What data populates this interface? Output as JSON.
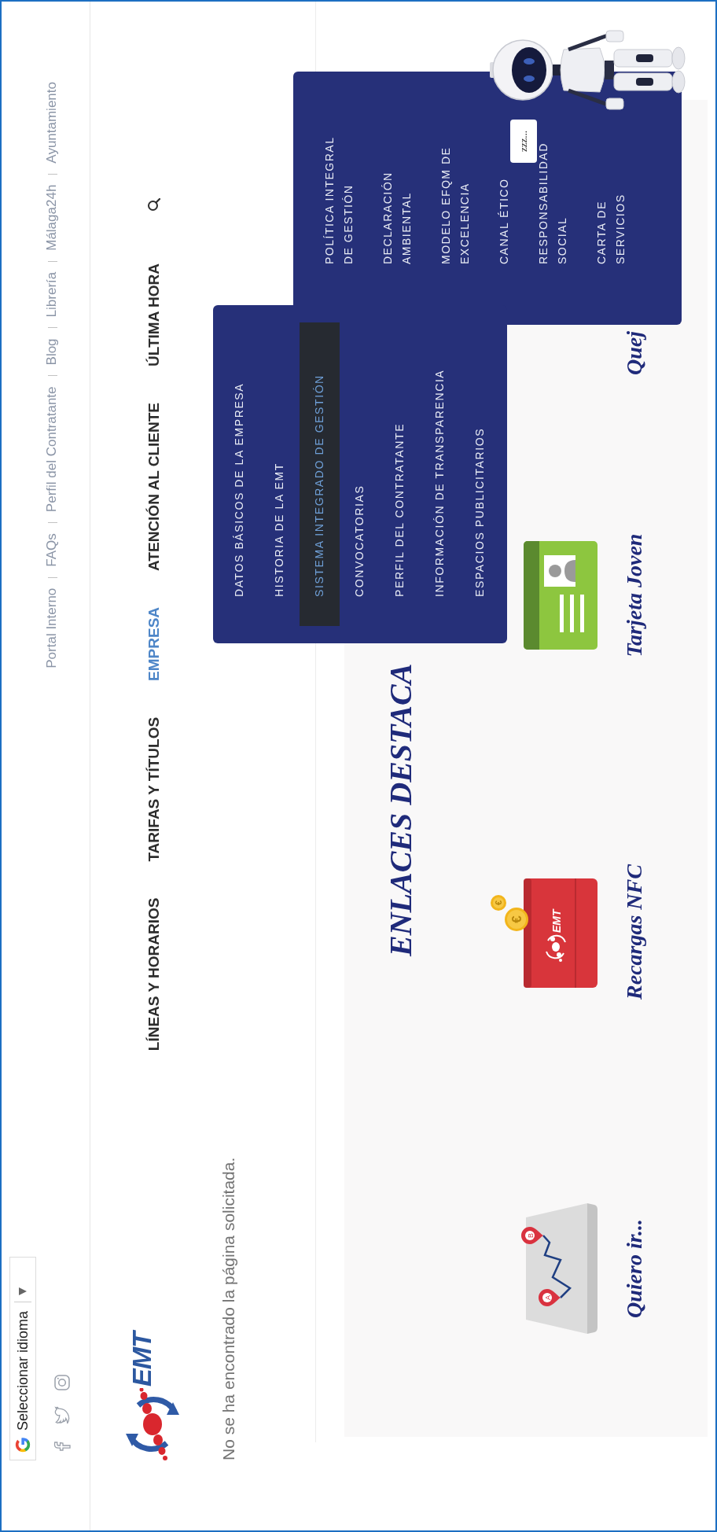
{
  "translate_widget": {
    "label": "Seleccionar idioma"
  },
  "top_links": [
    "Portal Interno",
    "FAQs",
    "Perfil del Contratante",
    "Blog",
    "Librería",
    "Málaga24h",
    "Ayuntamiento"
  ],
  "logo": {
    "text": "EMT"
  },
  "nav": [
    {
      "label": "LÍNEAS Y HORARIOS",
      "selected": false
    },
    {
      "label": "TARIFAS Y TÍTULOS",
      "selected": false
    },
    {
      "label": "EMPRESA",
      "selected": true
    },
    {
      "label": "ATENCIÓN AL CLIENTE",
      "selected": false
    },
    {
      "label": "ÚLTIMA HORA",
      "selected": false
    }
  ],
  "message": "No se ha encontrado la página solicitada.",
  "featured": {
    "title": "ENLACES DESTACA",
    "cards": [
      {
        "kind": "route-map",
        "label": "Quiero ir...",
        "pins": [
          "A",
          "B"
        ]
      },
      {
        "kind": "nfc-card",
        "label": "Recargas NFC",
        "logo": "EMT",
        "coins": [
          "€",
          "€"
        ]
      },
      {
        "kind": "id-card",
        "label": "Tarjeta Joven"
      },
      {
        "kind": "none",
        "label": "Quej"
      }
    ]
  },
  "dropdown": {
    "items": [
      {
        "label": "DATOS BÁSICOS DE LA EMPRESA",
        "selected": false
      },
      {
        "label": "HISTORIA DE LA EMT",
        "selected": false
      },
      {
        "label": "SISTEMA INTEGRADO DE GESTIÓN",
        "selected": true
      },
      {
        "label": "CONVOCATORIAS",
        "selected": false
      },
      {
        "label": "PERFIL DEL CONTRATANTE",
        "selected": false
      },
      {
        "label": "INFORMACIÓN DE TRANSPARENCIA",
        "selected": false
      },
      {
        "label": "ESPACIOS PUBLICITARIOS",
        "selected": false
      }
    ]
  },
  "submenu": {
    "items": [
      "POLÍTICA INTEGRAL DE GESTIÓN",
      "DECLARACIÓN AMBIENTAL",
      "MODELO EFQM DE EXCELENCIA",
      "CANAL ÉTICO",
      "RESPONSABILIDAD SOCIAL",
      "CARTA DE SERVICIOS"
    ]
  },
  "assistant": {
    "bubble": "zzz..."
  }
}
